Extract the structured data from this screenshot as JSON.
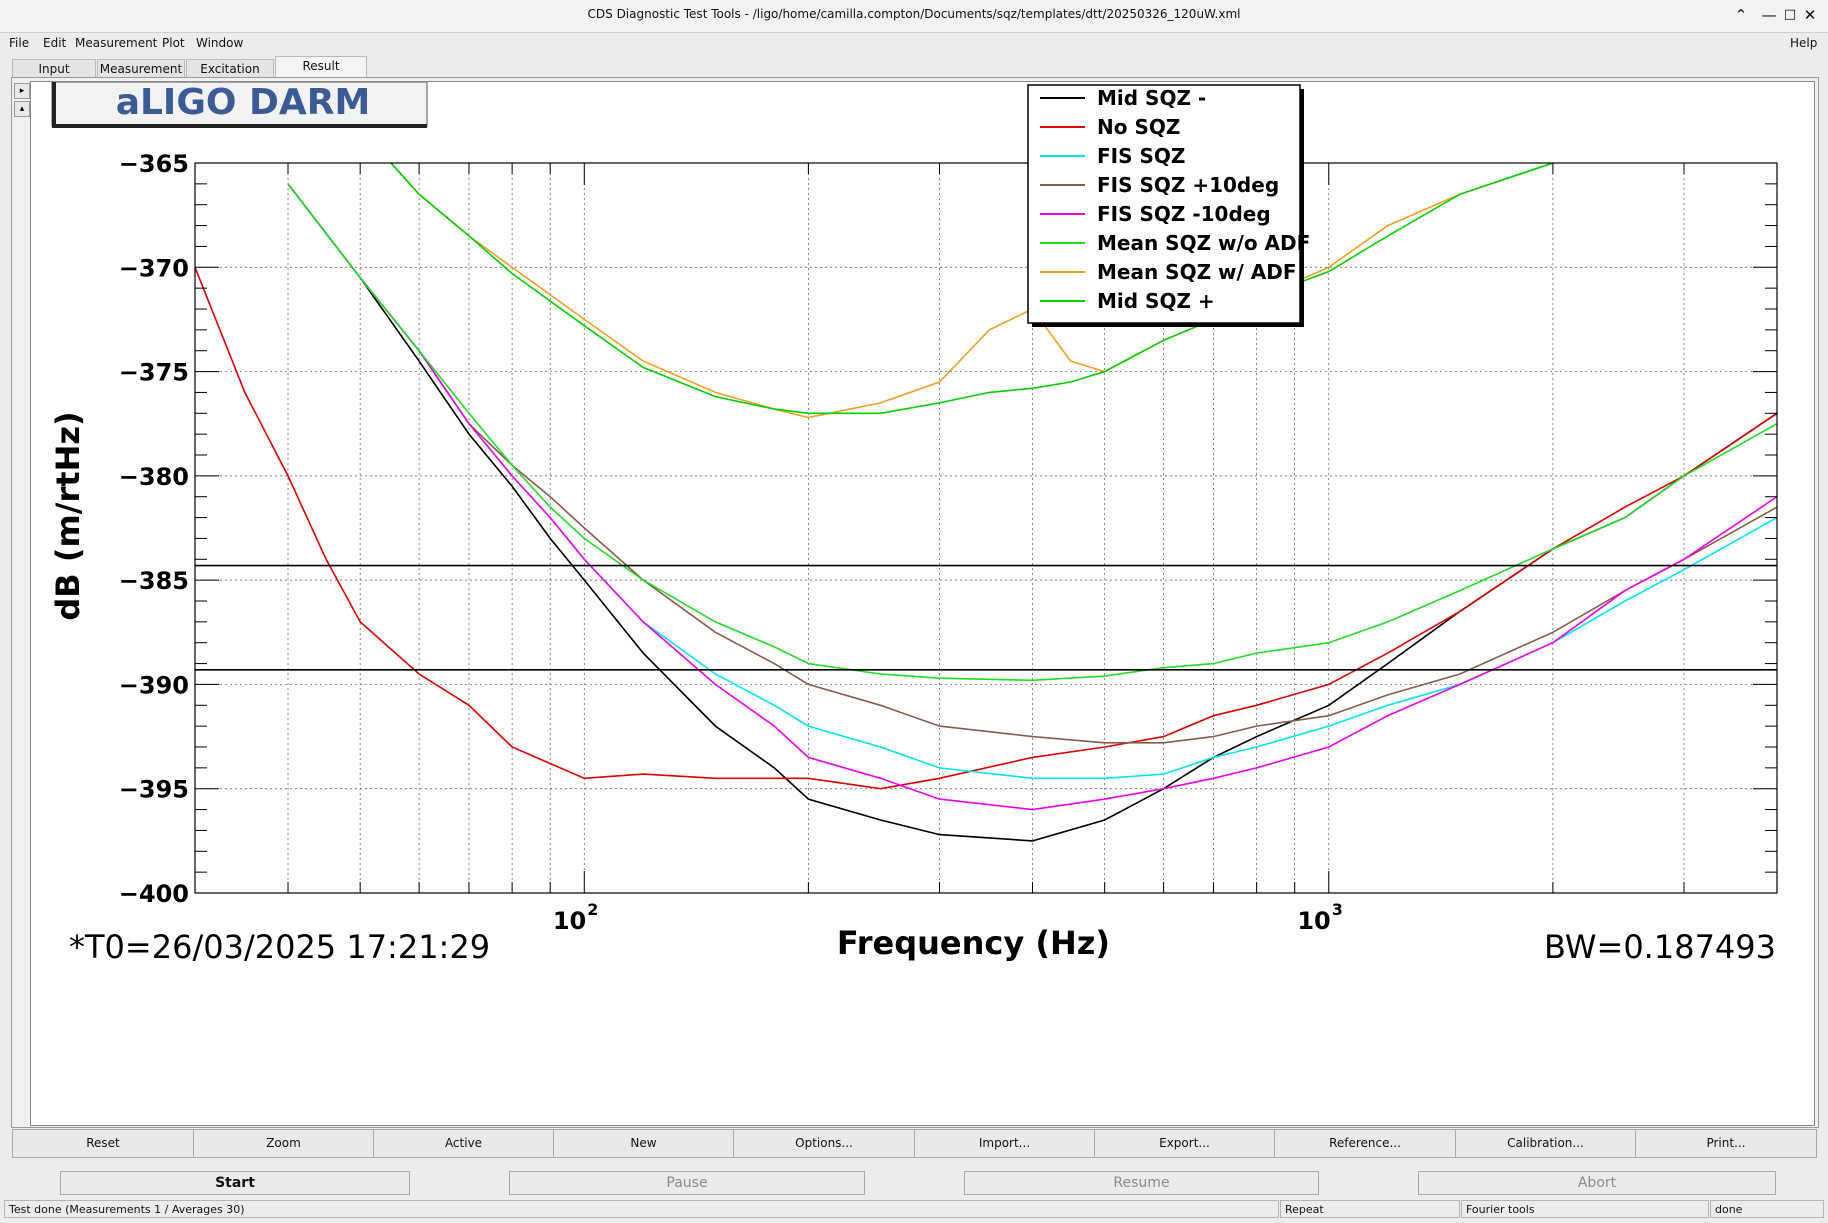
{
  "window": {
    "title": "CDS Diagnostic Test Tools - /ligo/home/camilla.compton/Documents/sqz/templates/dtt/20250326_120uW.xml"
  },
  "menu": [
    {
      "label": "File",
      "accel": "F"
    },
    {
      "label": "Edit",
      "accel": "E"
    },
    {
      "label": "Measurement",
      "accel": "M"
    },
    {
      "label": "Plot",
      "accel": "P"
    },
    {
      "label": "Window",
      "accel": "W"
    }
  ],
  "help_label": "Help",
  "tabs": [
    {
      "label": "Input"
    },
    {
      "label": "Measurement"
    },
    {
      "label": "Excitation"
    },
    {
      "label": "Result"
    }
  ],
  "plot": {
    "pad_title": "aLIGO DARM",
    "t0_label": "*T0=26/03/2025 17:21:29",
    "bw_label": "BW=0.187493",
    "y_tick_labels": [
      "−365",
      "−370",
      "−375",
      "−380",
      "−385",
      "−390",
      "−395",
      "−400"
    ],
    "x_tick_labels": [
      {
        "base": "10",
        "exp": "2"
      },
      {
        "base": "10",
        "exp": "3"
      }
    ]
  },
  "chart_data": {
    "type": "line",
    "xlabel": "Frequency (Hz)",
    "ylabel": "dB (m/rtHz)",
    "x_scale": "log",
    "xlim": [
      30,
      4000
    ],
    "ylim": [
      -400,
      -365
    ],
    "grid": true,
    "legend_position": "top-center",
    "horizontal_lines": [
      -384.3,
      -389.3
    ],
    "series": [
      {
        "name": "Mid SQZ -",
        "color": "#000000",
        "x": [
          40,
          50,
          60,
          70,
          80,
          90,
          100,
          120,
          150,
          180,
          200,
          250,
          300,
          400,
          500,
          600,
          700,
          800,
          1000,
          1200,
          1500,
          2000,
          2500,
          3000,
          4000
        ],
        "y": [
          -366,
          -370.5,
          -374.5,
          -378,
          -380.5,
          -383,
          -385,
          -388.5,
          -392,
          -394,
          -395.5,
          -396.5,
          -397.2,
          -397.5,
          -396.5,
          -395,
          -393.5,
          -392.5,
          -391,
          -389,
          -386.5,
          -383.5,
          -382,
          -380,
          -377
        ]
      },
      {
        "name": "No SQZ",
        "color": "#e00000",
        "x": [
          30,
          35,
          40,
          45,
          50,
          60,
          70,
          80,
          100,
          120,
          150,
          200,
          250,
          300,
          400,
          500,
          600,
          700,
          800,
          1000,
          1200,
          1500,
          2000,
          2500,
          3000,
          4000
        ],
        "y": [
          -370,
          -376,
          -380,
          -384,
          -387,
          -389.5,
          -391,
          -393,
          -394.5,
          -394.3,
          -394.5,
          -394.5,
          -395,
          -394.5,
          -393.5,
          -393,
          -392.5,
          -391.5,
          -391,
          -390,
          -388.5,
          -386.5,
          -383.5,
          -381.5,
          -380,
          -377
        ]
      },
      {
        "name": "FIS SQZ",
        "color": "#00e5ee",
        "x": [
          40,
          50,
          60,
          70,
          80,
          90,
          100,
          120,
          150,
          180,
          200,
          250,
          300,
          400,
          500,
          600,
          700,
          800,
          1000,
          1200,
          1500,
          2000,
          2500,
          3000,
          4000
        ],
        "y": [
          -366,
          -370.5,
          -374,
          -377.5,
          -380,
          -382,
          -384,
          -387,
          -389.5,
          -391,
          -392,
          -393,
          -394,
          -394.5,
          -394.5,
          -394.3,
          -393.5,
          -393,
          -392,
          -391,
          -390,
          -388,
          -386,
          -384.5,
          -382
        ]
      },
      {
        "name": "FIS SQZ +10deg",
        "color": "#8b5a4a",
        "x": [
          40,
          50,
          60,
          70,
          80,
          90,
          100,
          120,
          150,
          180,
          200,
          250,
          300,
          400,
          500,
          600,
          700,
          800,
          1000,
          1200,
          1500,
          2000,
          2500,
          3000,
          4000
        ],
        "y": [
          -366,
          -370.5,
          -374,
          -377.5,
          -379.5,
          -381,
          -382.5,
          -385,
          -387.5,
          -389,
          -390,
          -391,
          -392,
          -392.5,
          -392.8,
          -392.8,
          -392.5,
          -392,
          -391.5,
          -390.5,
          -389.5,
          -387.5,
          -385.5,
          -384,
          -381.5
        ]
      },
      {
        "name": "FIS SQZ -10deg",
        "color": "#ee00ee",
        "x": [
          40,
          50,
          60,
          70,
          80,
          90,
          100,
          120,
          150,
          180,
          200,
          250,
          300,
          400,
          500,
          600,
          700,
          800,
          1000,
          1200,
          1500,
          2000,
          2500,
          3000,
          4000
        ],
        "y": [
          -366,
          -370.5,
          -374,
          -377.5,
          -380,
          -382,
          -384,
          -387,
          -390,
          -392,
          -393.5,
          -394.5,
          -395.5,
          -396,
          -395.5,
          -395,
          -394.5,
          -394,
          -393,
          -391.5,
          -390,
          -388,
          -385.5,
          -384,
          -381
        ]
      },
      {
        "name": "Mean SQZ w/o ADF",
        "color": "#22dd22",
        "x": [
          40,
          50,
          60,
          70,
          80,
          90,
          100,
          120,
          150,
          180,
          200,
          250,
          300,
          400,
          500,
          600,
          700,
          800,
          1000,
          1200,
          1500,
          2000,
          2500,
          3000,
          4000
        ],
        "y": [
          -366,
          -370.5,
          -374,
          -377,
          -379.5,
          -381.5,
          -383,
          -385,
          -387,
          -388.2,
          -389,
          -389.5,
          -389.7,
          -389.8,
          -389.6,
          -389.2,
          -389,
          -388.5,
          -388,
          -387,
          -385.5,
          -383.5,
          -382,
          -380,
          -377.5
        ]
      },
      {
        "name": "Mean SQZ w/ ADF",
        "color": "#f0a020",
        "x": [
          55,
          60,
          70,
          80,
          100,
          120,
          150,
          180,
          200,
          250,
          300,
          350,
          400,
          450,
          500,
          600,
          700,
          800,
          1000,
          1200,
          1500,
          2000
        ],
        "y": [
          -365,
          -366.5,
          -368.5,
          -370,
          -372.5,
          -374.5,
          -376,
          -376.8,
          -377.2,
          -376.5,
          -375.5,
          -373,
          -372,
          -374.5,
          -375,
          -373.5,
          -372.5,
          -371.5,
          -370,
          -368,
          -366.5,
          -365
        ]
      },
      {
        "name": "Mid SQZ +",
        "color": "#00d000",
        "x": [
          55,
          60,
          70,
          80,
          100,
          120,
          150,
          180,
          200,
          250,
          300,
          350,
          400,
          450,
          500,
          600,
          700,
          800,
          1000,
          1200,
          1500,
          2000
        ],
        "y": [
          -365,
          -366.5,
          -368.5,
          -370.3,
          -372.8,
          -374.8,
          -376.2,
          -376.8,
          -377,
          -377,
          -376.5,
          -376,
          -375.8,
          -375.5,
          -375,
          -373.5,
          -372.5,
          -371.5,
          -370.2,
          -368.5,
          -366.5,
          -365
        ]
      }
    ]
  },
  "plot_toolbar": [
    {
      "label": "Reset"
    },
    {
      "label": "Zoom"
    },
    {
      "label": "Active"
    },
    {
      "label": "New"
    },
    {
      "label": "Options..."
    },
    {
      "label": "Import..."
    },
    {
      "label": "Export..."
    },
    {
      "label": "Reference..."
    },
    {
      "label": "Calibration..."
    },
    {
      "label": "Print..."
    }
  ],
  "controls": [
    {
      "label": "Start",
      "enabled": true
    },
    {
      "label": "Pause",
      "enabled": false
    },
    {
      "label": "Resume",
      "enabled": false
    },
    {
      "label": "Abort",
      "enabled": false
    }
  ],
  "status": {
    "message": "Test done (Measurements 1 / Averages 30)",
    "mode": "Repeat",
    "tool": "Fourier tools",
    "state": "done"
  }
}
